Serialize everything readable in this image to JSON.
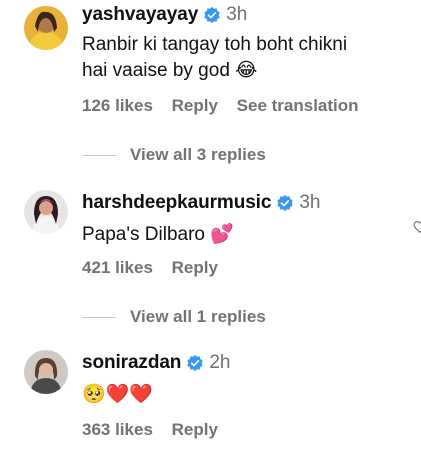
{
  "comments": [
    {
      "username": "yashvayayay",
      "time": "3h",
      "text_line1": "Ranbir ki tangay toh boht chikni",
      "text_line2": "hai vaaise by god",
      "emoji": "😂",
      "likes": "126 likes",
      "reply": "Reply",
      "translation": "See translation",
      "view_replies": "View all 3 replies"
    },
    {
      "username": "harshdeepkaurmusic",
      "time": "3h",
      "text": "Papa's Dilbaro",
      "emoji": "💕",
      "likes": "421 likes",
      "reply": "Reply",
      "view_replies": "View all 1 replies"
    },
    {
      "username": "sonirazdan",
      "time": "2h",
      "emoji": "🥺❤️❤️",
      "likes": "363 likes",
      "reply": "Reply"
    }
  ],
  "colors": {
    "verified": "#3897f0",
    "secondary_text": "#737373",
    "timestamp": "#707070"
  },
  "icons": {
    "verified": "verified-badge-icon",
    "like": "heart-icon"
  }
}
